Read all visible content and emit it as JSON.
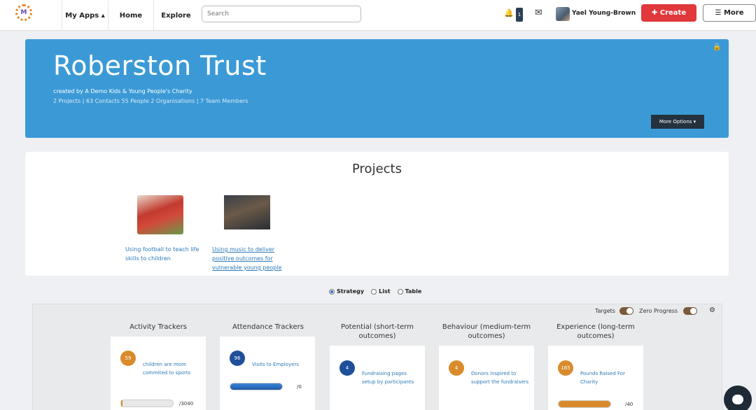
{
  "nav": {
    "logo_letter": "M",
    "my_apps": "My Apps ▴",
    "home": "Home",
    "explore": "Explore",
    "search_placeholder": "Search",
    "notification_count": "1",
    "username": "Yael Young-Brown",
    "create": "✚ Create",
    "more": "☰ More"
  },
  "hero": {
    "title": "Roberston Trust",
    "created_by": "created by A Demo Kids & Young People's Charity",
    "stats": "2 Projects | 63 Contacts  55 People  2 Organisations  | 7 Team Members",
    "more_options": "More Options ▾"
  },
  "projects": {
    "title": "Projects",
    "items": [
      {
        "caption": "Using football to teach life skills to children"
      },
      {
        "caption": "Using music to deliver positive outcomes for vulnerable young people"
      }
    ]
  },
  "view": {
    "strategy": "Strategy",
    "list": "List",
    "table": "Table",
    "selected": "Strategy"
  },
  "strategy": {
    "targets_label": "Targets",
    "zero_progress_label": "Zero Progress",
    "columns": [
      {
        "title": "Activity Trackers",
        "count": "59",
        "text": "children are more commited to sports",
        "total": "/3040",
        "color": "#d98b2b",
        "progress": 0.02
      },
      {
        "title": "Attendance Trackers",
        "count": "96",
        "text": "Visits to Employers",
        "total": "/0",
        "color": "#1f4f9a",
        "progress": 1.0
      },
      {
        "title": "Potential (short-term outcomes)",
        "count": "4",
        "text": "Fundraising pages setup by participants",
        "total": "",
        "color": "#1f4f9a",
        "progress": 0.0
      },
      {
        "title": "Behaviour (medium-term outcomes)",
        "count": "4",
        "text": "Donors inspired to support the fundraisers",
        "total": "",
        "color": "#d98b2b",
        "progress": 0.0
      },
      {
        "title": "Experience (long-term outcomes)",
        "count": "165",
        "text": "Pounds Raised For Charity",
        "total": "/40",
        "color": "#d98b2b",
        "progress": 1.0
      }
    ]
  }
}
